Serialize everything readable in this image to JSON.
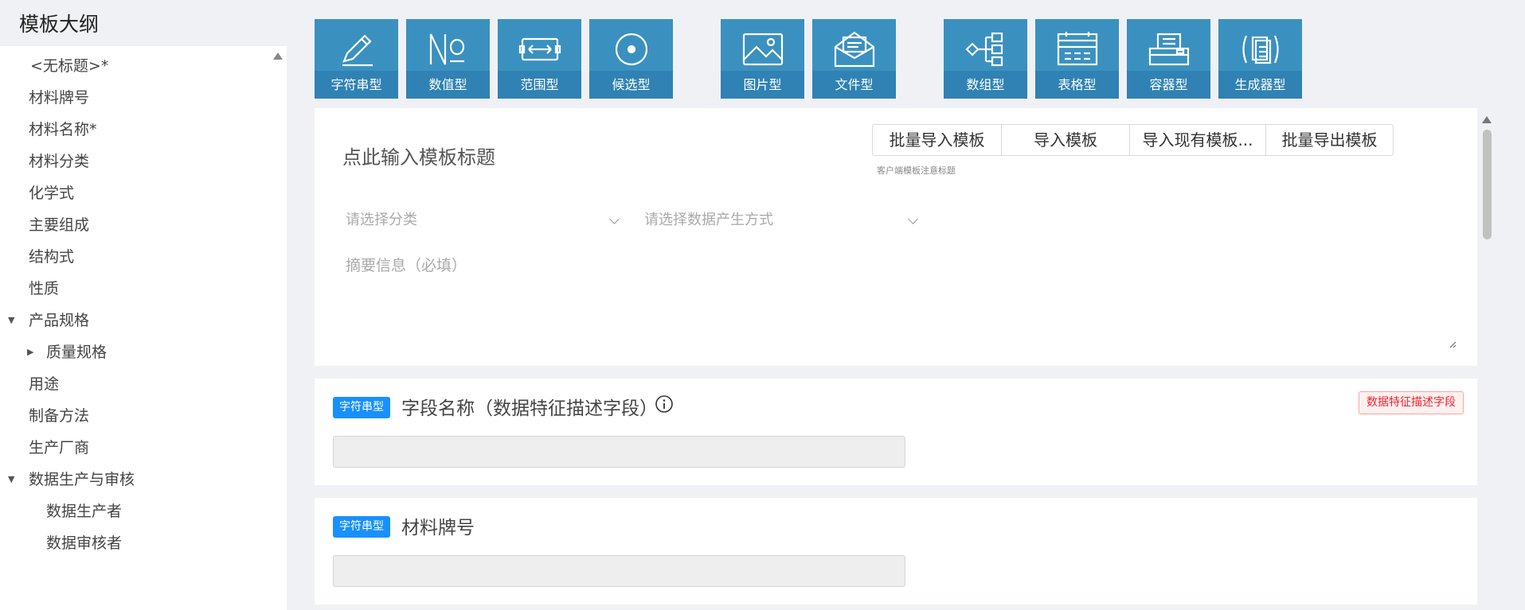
{
  "sidebar": {
    "title": "模板大纲",
    "items": [
      {
        "label": "<无标题>*"
      },
      {
        "label": "材料牌号"
      },
      {
        "label": "材料名称*"
      },
      {
        "label": "材料分类"
      },
      {
        "label": "化学式"
      },
      {
        "label": "主要组成"
      },
      {
        "label": "结构式"
      },
      {
        "label": "性质"
      },
      {
        "label": "产品规格"
      },
      {
        "label": "质量规格"
      },
      {
        "label": "用途"
      },
      {
        "label": "制备方法"
      },
      {
        "label": "生产厂商"
      },
      {
        "label": "数据生产与审核"
      },
      {
        "label": "数据生产者"
      },
      {
        "label": "数据审核者"
      }
    ]
  },
  "toolbar": {
    "tools": [
      {
        "label": "字符串型",
        "icon": "pencil-icon"
      },
      {
        "label": "数值型",
        "icon": "numero-icon"
      },
      {
        "label": "范围型",
        "icon": "range-icon"
      },
      {
        "label": "候选型",
        "icon": "radio-icon"
      },
      {
        "label": "图片型",
        "icon": "image-icon"
      },
      {
        "label": "文件型",
        "icon": "file-icon"
      },
      {
        "label": "数组型",
        "icon": "array-icon"
      },
      {
        "label": "表格型",
        "icon": "table-icon"
      },
      {
        "label": "容器型",
        "icon": "container-icon"
      },
      {
        "label": "生成器型",
        "icon": "generator-icon"
      }
    ]
  },
  "header": {
    "title_placeholder": "点此输入模板标题",
    "buttons": {
      "batch_import": "批量导入模板",
      "import": "导入模板",
      "import_existing": "导入现有模板...",
      "batch_export": "批量导出模板"
    },
    "hint": "客户端模板注意标题",
    "category_placeholder": "请选择分类",
    "method_placeholder": "请选择数据产生方式",
    "summary_placeholder": "摘要信息（必填）"
  },
  "fields": [
    {
      "type_tag": "字符串型",
      "title": "字段名称（数据特征描述字段）",
      "badge": "数据特征描述字段"
    },
    {
      "type_tag": "字符串型",
      "title": "材料牌号"
    }
  ],
  "colors": {
    "tool_bg": "#3a91bf",
    "tool_label_bg": "#2f82b3",
    "tag_blue": "#1890ff",
    "tag_red": "#f5222d"
  }
}
